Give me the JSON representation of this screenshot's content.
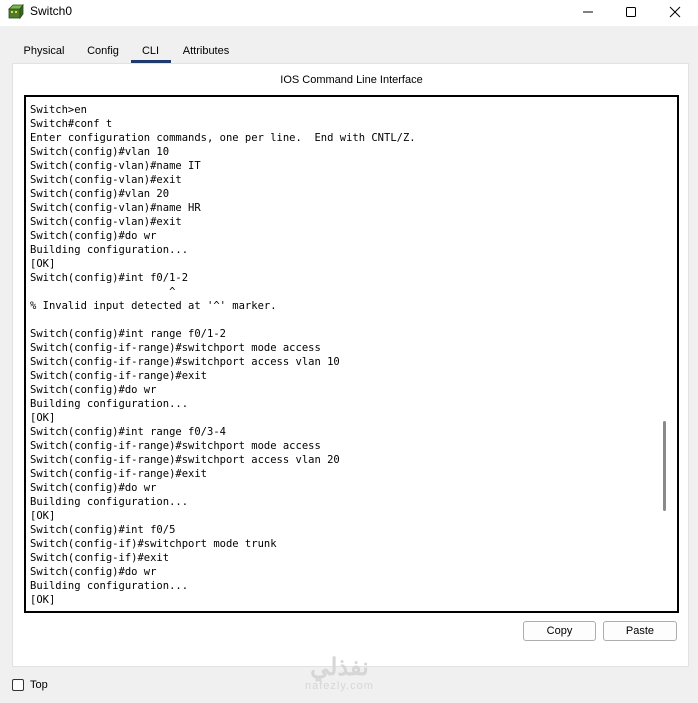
{
  "window": {
    "title": "Switch0",
    "icon": "switch-icon",
    "controls": [
      "minimize-icon",
      "maximize-icon",
      "close-icon"
    ]
  },
  "tabs": [
    {
      "label": "Physical",
      "active": false
    },
    {
      "label": "Config",
      "active": false
    },
    {
      "label": "CLI",
      "active": true
    },
    {
      "label": "Attributes",
      "active": false
    }
  ],
  "panel": {
    "header": "IOS Command Line Interface"
  },
  "terminal": {
    "lines": [
      "Switch>en",
      "Switch#conf t",
      "Enter configuration commands, one per line.  End with CNTL/Z.",
      "Switch(config)#vlan 10",
      "Switch(config-vlan)#name IT",
      "Switch(config-vlan)#exit",
      "Switch(config)#vlan 20",
      "Switch(config-vlan)#name HR",
      "Switch(config-vlan)#exit",
      "Switch(config)#do wr",
      "Building configuration...",
      "[OK]",
      "Switch(config)#int f0/1-2",
      "                      ^",
      "% Invalid input detected at '^' marker.",
      "",
      "Switch(config)#int range f0/1-2",
      "Switch(config-if-range)#switchport mode access",
      "Switch(config-if-range)#switchport access vlan 10",
      "Switch(config-if-range)#exit",
      "Switch(config)#do wr",
      "Building configuration...",
      "[OK]",
      "Switch(config)#int range f0/3-4",
      "Switch(config-if-range)#switchport mode access",
      "Switch(config-if-range)#switchport access vlan 20",
      "Switch(config-if-range)#exit",
      "Switch(config)#do wr",
      "Building configuration...",
      "[OK]",
      "Switch(config)#int f0/5",
      "Switch(config-if)#switchport mode trunk",
      "Switch(config-if)#exit",
      "Switch(config)#do wr",
      "Building configuration...",
      "[OK]"
    ]
  },
  "buttons": {
    "copy_label": "Copy",
    "paste_label": "Paste"
  },
  "footer": {
    "top_checkbox_label": "Top",
    "top_checked": false
  },
  "watermark": {
    "arabic": "نفذلي",
    "latin": "nafezly.com"
  },
  "colors": {
    "active_tab_underline": "#1e3a6e",
    "terminal_border": "#000000",
    "window_bg": "#f0f0f0"
  }
}
